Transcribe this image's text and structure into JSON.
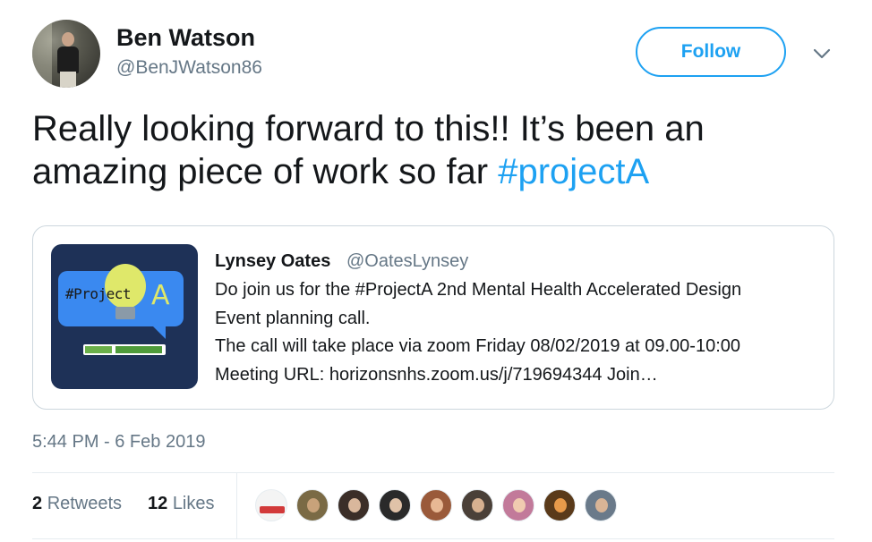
{
  "tweet": {
    "author_name": "Ben Watson",
    "author_handle": "@BenJWatson86",
    "follow_label": "Follow",
    "text_main": "Really looking forward to this!! It’s been an amazing piece of work so far ",
    "hashtag": "#projectA",
    "timestamp": "5:44 PM - 6 Feb 2019"
  },
  "quoted": {
    "name": "Lynsey Oates",
    "handle": "@OatesLynsey",
    "lines": [
      "Do join us for the #ProjectA 2nd Mental Health Accelerated Design",
      "Event planning call.",
      "The call will take place via zoom Friday 08/02/2019 at 09.00-10:00",
      "Meeting URL: horizonsnhs.zoom.us/j/719694344 Join…"
    ],
    "image_logo_text": "#ProjectA"
  },
  "stats": {
    "retweets_count": "2",
    "retweets_label": "Retweets",
    "likes_count": "12",
    "likes_label": "Likes"
  },
  "colors": {
    "accent": "#1da1f2",
    "text_primary": "#14171a",
    "text_secondary": "#657786",
    "border": "#e6ecf0"
  },
  "icons": {
    "caret": "chevron-down-icon"
  }
}
